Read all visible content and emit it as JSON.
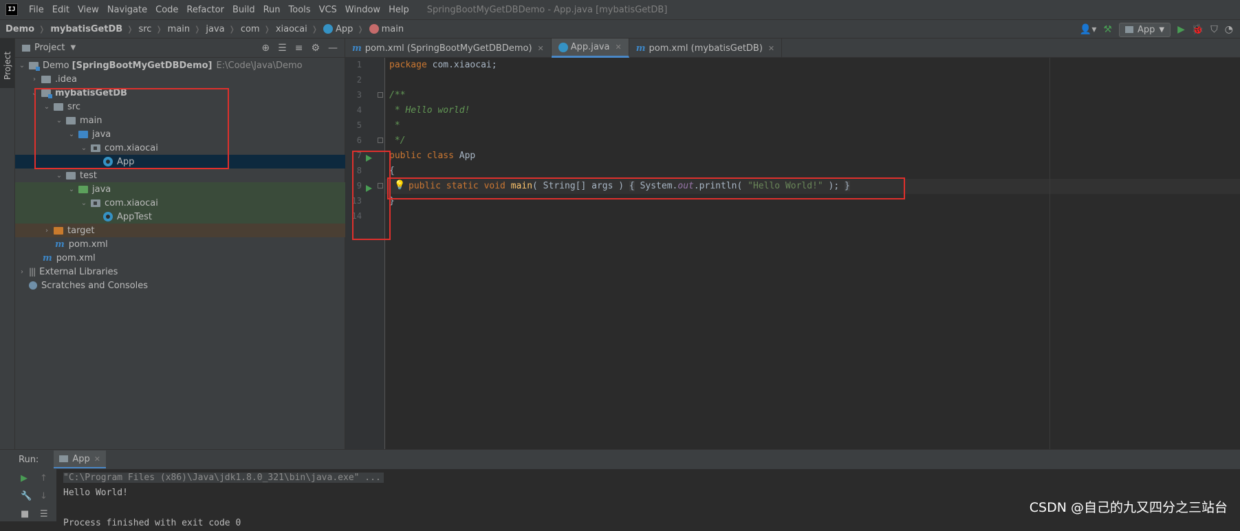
{
  "menubar": {
    "logo": "IJ",
    "items": [
      "File",
      "Edit",
      "View",
      "Navigate",
      "Code",
      "Refactor",
      "Build",
      "Run",
      "Tools",
      "VCS",
      "Window",
      "Help"
    ],
    "window_title": "SpringBootMyGetDBDemo - App.java [mybatisGetDB]"
  },
  "navbar": {
    "crumbs": [
      "Demo",
      "mybatisGetDB",
      "src",
      "main",
      "java",
      "com",
      "xiaocai",
      "App",
      "main"
    ],
    "run_config": "App"
  },
  "sidebar_stripe": {
    "project_label": "Project"
  },
  "project_panel": {
    "title": "Project",
    "tree": [
      {
        "label": "Demo",
        "bold_suffix": "[SpringBootMyGetDBDemo]",
        "path": "E:\\Code\\Java\\Demo"
      },
      {
        "label": ".idea"
      },
      {
        "label": "mybatisGetDB"
      },
      {
        "label": "src"
      },
      {
        "label": "main"
      },
      {
        "label": "java"
      },
      {
        "label": "com.xiaocai"
      },
      {
        "label": "App"
      },
      {
        "label": "test"
      },
      {
        "label": "java"
      },
      {
        "label": "com.xiaocai"
      },
      {
        "label": "AppTest"
      },
      {
        "label": "target"
      },
      {
        "label": "pom.xml"
      },
      {
        "label": "pom.xml"
      },
      {
        "label": "External Libraries"
      },
      {
        "label": "Scratches and Consoles"
      }
    ]
  },
  "editor": {
    "tabs": [
      {
        "label": "pom.xml (SpringBootMyGetDBDemo)"
      },
      {
        "label": "App.java"
      },
      {
        "label": "pom.xml (mybatisGetDB)"
      }
    ],
    "line_numbers": [
      "1",
      "2",
      "3",
      "4",
      "5",
      "6",
      "7",
      "8",
      "9",
      "13",
      "14"
    ],
    "code": {
      "l1_kw": "package",
      "l1_rest": " com.xiaocai;",
      "l3": "/**",
      "l4": " * Hello world!",
      "l5": " *",
      "l6": " */",
      "l7_kw": "public class",
      "l7_rest": " App",
      "l8": "{",
      "l9_kw": "public static void",
      "l9_fn": "main",
      "l9_args": "( String[] args ) ",
      "l9_fold_open": "{",
      "l9_body1": " System.",
      "l9_static": "out",
      "l9_body2": ".println( ",
      "l9_str": "\"Hello World!\"",
      "l9_body3": " ); ",
      "l9_fold_close": "}",
      "l13": "}"
    }
  },
  "run_panel": {
    "label": "Run:",
    "tab": "App",
    "output": [
      "\"C:\\Program Files (x86)\\Java\\jdk1.8.0_321\\bin\\java.exe\" ...",
      "Hello World!",
      "",
      "Process finished with exit code 0"
    ]
  },
  "watermark": "CSDN @自己的九又四分之三站台",
  "colors": {
    "background": "#2b2b2b",
    "panel": "#3c3f41",
    "keyword": "#cc7832",
    "comment": "#629755",
    "string": "#6a8759",
    "function": "#ffc66d",
    "highlight_box": "#e0302c",
    "selection": "#0d293e"
  }
}
